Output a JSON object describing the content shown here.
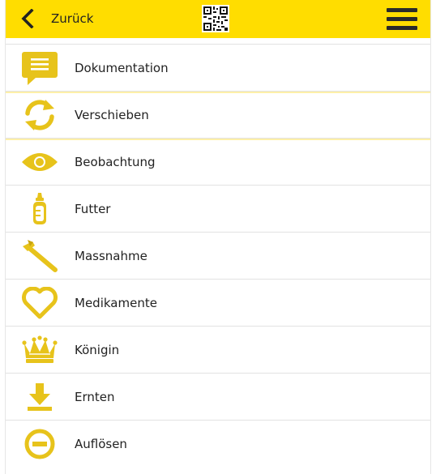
{
  "header": {
    "back_label": "Zurück"
  },
  "menu_items": [
    {
      "label": "Dokumentation",
      "icon": "comment-icon"
    },
    {
      "label": "Verschieben",
      "icon": "sync-arrows-icon"
    },
    {
      "label": "Beobachtung",
      "icon": "eye-icon"
    },
    {
      "label": "Futter",
      "icon": "baby-bottle-icon"
    },
    {
      "label": "Massnahme",
      "icon": "tool-icon"
    },
    {
      "label": "Medikamente",
      "icon": "heart-icon"
    },
    {
      "label": "Königin",
      "icon": "crown-icon"
    },
    {
      "label": "Ernten",
      "icon": "download-arrow-icon"
    },
    {
      "label": "Auflösen",
      "icon": "minus-circle-icon"
    }
  ],
  "colors": {
    "header": "#ffdd00",
    "icon": "#e7c31b",
    "icon_dark": "#c9a50f",
    "text": "#222222"
  }
}
